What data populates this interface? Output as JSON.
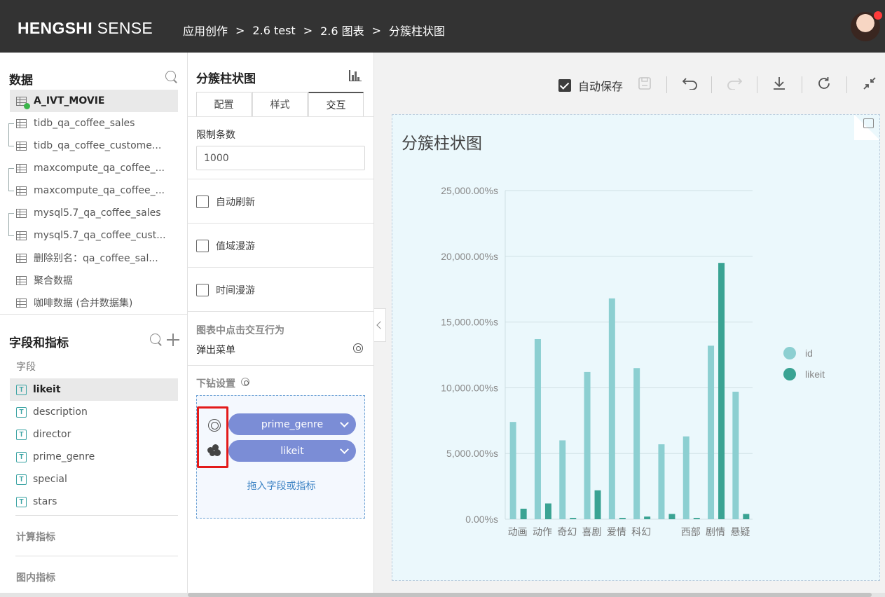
{
  "header": {
    "brand_bold": "HENGSHI",
    "brand_rest": " SENSE",
    "breadcrumb": [
      "应用创作",
      "2.6 test",
      "2.6 图表",
      "分簇柱状图"
    ],
    "separator": ">"
  },
  "data_panel": {
    "title": "数据",
    "datasets": [
      {
        "label": "A_IVT_MOVIE",
        "selected": true
      },
      {
        "label": "tidb_qa_coffee_sales"
      },
      {
        "label": "tidb_qa_coffee_custome..."
      },
      {
        "label": "maxcompute_qa_coffee_..."
      },
      {
        "label": "maxcompute_qa_coffee_..."
      },
      {
        "label": "mysql5.7_qa_coffee_sales"
      },
      {
        "label": "mysql5.7_qa_coffee_cust..."
      },
      {
        "label": "删除别名：qa_coffee_sal..."
      },
      {
        "label": "聚合数据"
      },
      {
        "label": "咖啡数据 (合并数据集)"
      }
    ]
  },
  "fields_panel": {
    "title": "字段和指标",
    "fields_label": "字段",
    "fields": [
      {
        "label": "likeit",
        "type": "T",
        "selected": true
      },
      {
        "label": "description",
        "type": "T"
      },
      {
        "label": "director",
        "type": "T"
      },
      {
        "label": "prime_genre",
        "type": "T"
      },
      {
        "label": "special",
        "type": "T"
      },
      {
        "label": "stars",
        "type": "T"
      }
    ],
    "calc_label": "计算指标",
    "inchart_label": "图内指标"
  },
  "config_panel": {
    "title": "分簇柱状图",
    "tabs": [
      {
        "label": "配置"
      },
      {
        "label": "样式"
      },
      {
        "label": "交互",
        "active": true
      }
    ],
    "limit_label": "限制条数",
    "limit_value": "1000",
    "checkboxes": [
      {
        "label": "自动刷新",
        "checked": false
      },
      {
        "label": "值域漫游",
        "checked": false
      },
      {
        "label": "时间漫游",
        "checked": false
      }
    ],
    "click_behavior_label": "图表中点击交互行为",
    "click_behavior_value": "弹出菜单",
    "drill_label": "下钻设置",
    "drill_fields": [
      "prime_genre",
      "likeit"
    ],
    "drop_hint": "拖入字段或指标"
  },
  "toolbar": {
    "autosave_label": "自动保存",
    "autosave_checked": true
  },
  "chart": {
    "title": "分簇柱状图"
  },
  "chart_data": {
    "type": "bar",
    "title": "分簇柱状图",
    "categories": [
      "动画",
      "动作",
      "奇幻",
      "喜剧",
      "爱情",
      "科幻",
      "",
      "西部",
      "剧情",
      "悬疑"
    ],
    "series": [
      {
        "name": "id",
        "color": "#8ccfd1",
        "values": [
          7400,
          13700,
          6000,
          11200,
          16800,
          11500,
          5700,
          6300,
          13200,
          9700
        ]
      },
      {
        "name": "likeit",
        "color": "#3aa393",
        "values": [
          800,
          1200,
          100,
          2200,
          100,
          200,
          400,
          100,
          19500,
          400
        ]
      }
    ],
    "yticks": [
      "0.00%s",
      "5,000.00%s",
      "10,000.00%s",
      "15,000.00%s",
      "20,000.00%s",
      "25,000.00%s"
    ],
    "ylim": [
      0,
      25000
    ],
    "legend_position": "right",
    "grid": true
  }
}
